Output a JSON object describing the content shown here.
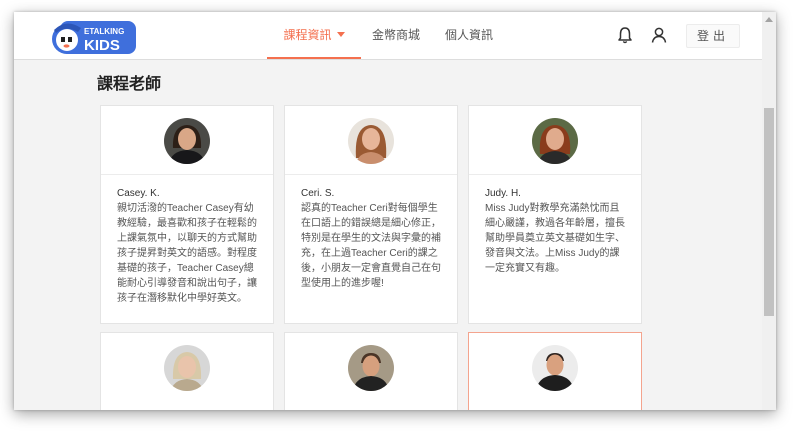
{
  "header": {
    "logo_line1": "ETALKING",
    "logo_line2": "KIDS",
    "nav": [
      {
        "label": "課程資訊",
        "active": true
      },
      {
        "label": "金幣商城",
        "active": false
      },
      {
        "label": "個人資訊",
        "active": false
      }
    ],
    "icons": [
      "bell-icon",
      "user-icon"
    ],
    "logout_label": "登出"
  },
  "section_title": "課程老師",
  "teachers": [
    {
      "name": "Casey. K.",
      "lines": [
        "親切活潑的Teacher Casey有幼",
        "教經驗，最喜歡和孩子在輕鬆的",
        "上課氣氛中，以聊天的方式幫助",
        "孩子提昇對英文的語感。對程度",
        "基礎的孩子，Teacher Casey總",
        "能耐心引導發音和說出句子，讓",
        "孩子在潛移默化中學好英文。"
      ]
    },
    {
      "name": "Ceri. S.",
      "lines": [
        "認真的Teacher Ceri對每個學生",
        "在口語上的錯誤總是細心修正，",
        "特別是在學生的文法與字彙的補",
        "充，在上過Teacher Ceri的課之",
        "後，小朋友一定會直覺自己在句",
        "型使用上的進步喔!"
      ]
    },
    {
      "name": "Judy. H.",
      "lines": [
        "Miss Judy對教學充滿熱忱而且",
        "細心嚴謹，教過各年齡層，擅長",
        "幫助學員奠立英文基礎如生字、",
        "發音與文法。上Miss Judy的課",
        "一定充實又有趣。"
      ]
    }
  ],
  "colors": {
    "accent": "#f4704f",
    "logo_blue": "#3f6fdc",
    "page_bg": "#f3f3f3"
  }
}
